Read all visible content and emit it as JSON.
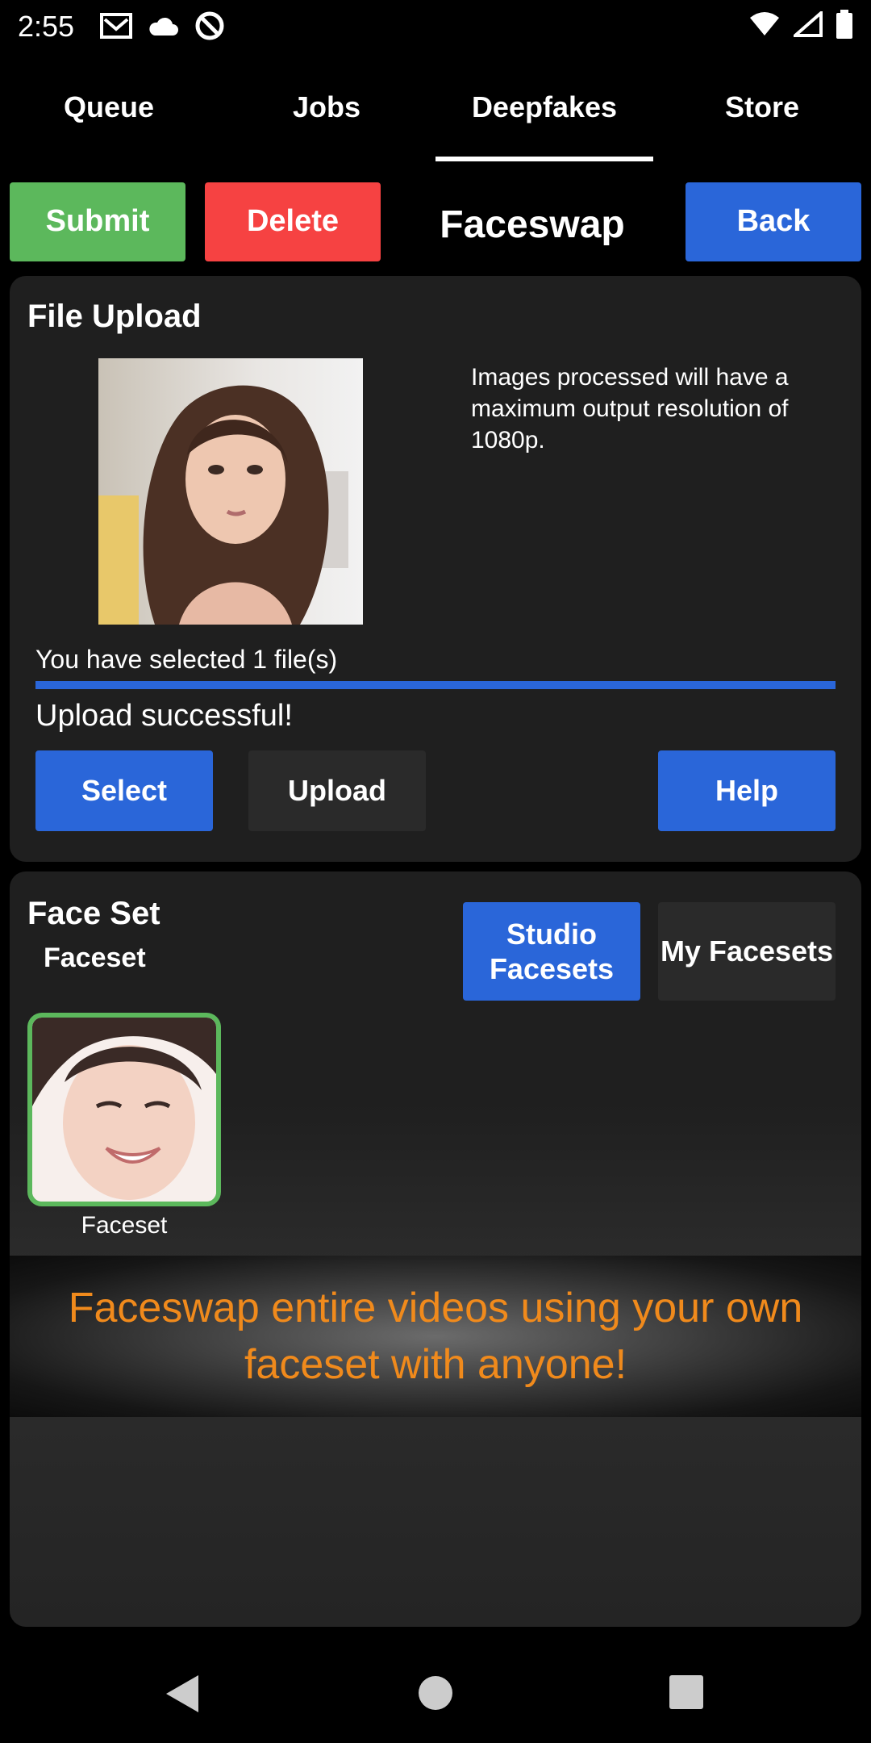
{
  "status_bar": {
    "time": "2:55",
    "left_icons": [
      "gmail-icon",
      "cloud-icon",
      "sync-icon"
    ],
    "right_icons": [
      "wifi-icon",
      "signal-icon",
      "battery-icon"
    ]
  },
  "tabs": [
    {
      "label": "Queue",
      "active": false
    },
    {
      "label": "Jobs",
      "active": false
    },
    {
      "label": "Deepfakes",
      "active": true
    },
    {
      "label": "Store",
      "active": false
    }
  ],
  "toolbar": {
    "submit_label": "Submit",
    "delete_label": "Delete",
    "title": "Faceswap",
    "back_label": "Back"
  },
  "file_upload": {
    "title": "File Upload",
    "info": "Images processed will have a maximum output resolution of 1080p.",
    "selected_text": "You have selected 1 file(s)",
    "progress_percent": 100,
    "status": "Upload successful!",
    "select_label": "Select",
    "upload_label": "Upload",
    "help_label": "Help"
  },
  "face_set": {
    "title": "Face Set",
    "subtitle": "Faceset",
    "studio_label": "Studio Facesets",
    "my_label": "My Facesets",
    "item_label": "Faceset"
  },
  "banner": {
    "text": "Faceswap entire videos using your own faceset with anyone!"
  },
  "colors": {
    "green": "#5cb85c",
    "red": "#f64242",
    "blue": "#2a66d9",
    "orange": "#f08a1c"
  }
}
